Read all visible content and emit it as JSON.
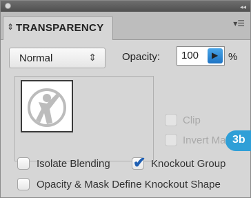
{
  "panel": {
    "title": "TRANSPARENCY"
  },
  "icons": {
    "tab_arrows": "double-chevron-icon",
    "menu": "panel-menu-icon",
    "blend_chevron": "up-down-chevron-icon",
    "opacity_arrow": "right-triangle-icon"
  },
  "blend_mode": {
    "value": "Normal",
    "chevron": "⇕"
  },
  "opacity": {
    "label": "Opacity:",
    "value": "100",
    "unit": "%",
    "arrow": "▶"
  },
  "mask": {
    "clip_label": "Clip",
    "invert_label": "Invert Mask"
  },
  "options": {
    "isolate_label": "Isolate Blending",
    "knockout_label": "Knockout Group",
    "define_label": "Opacity & Mask Define Knockout Shape"
  },
  "callout": {
    "label": "3b"
  },
  "colors": {
    "accent": "#2f9fd7",
    "check": "#1f5fb3",
    "panel_bg": "#d6d6d6"
  }
}
